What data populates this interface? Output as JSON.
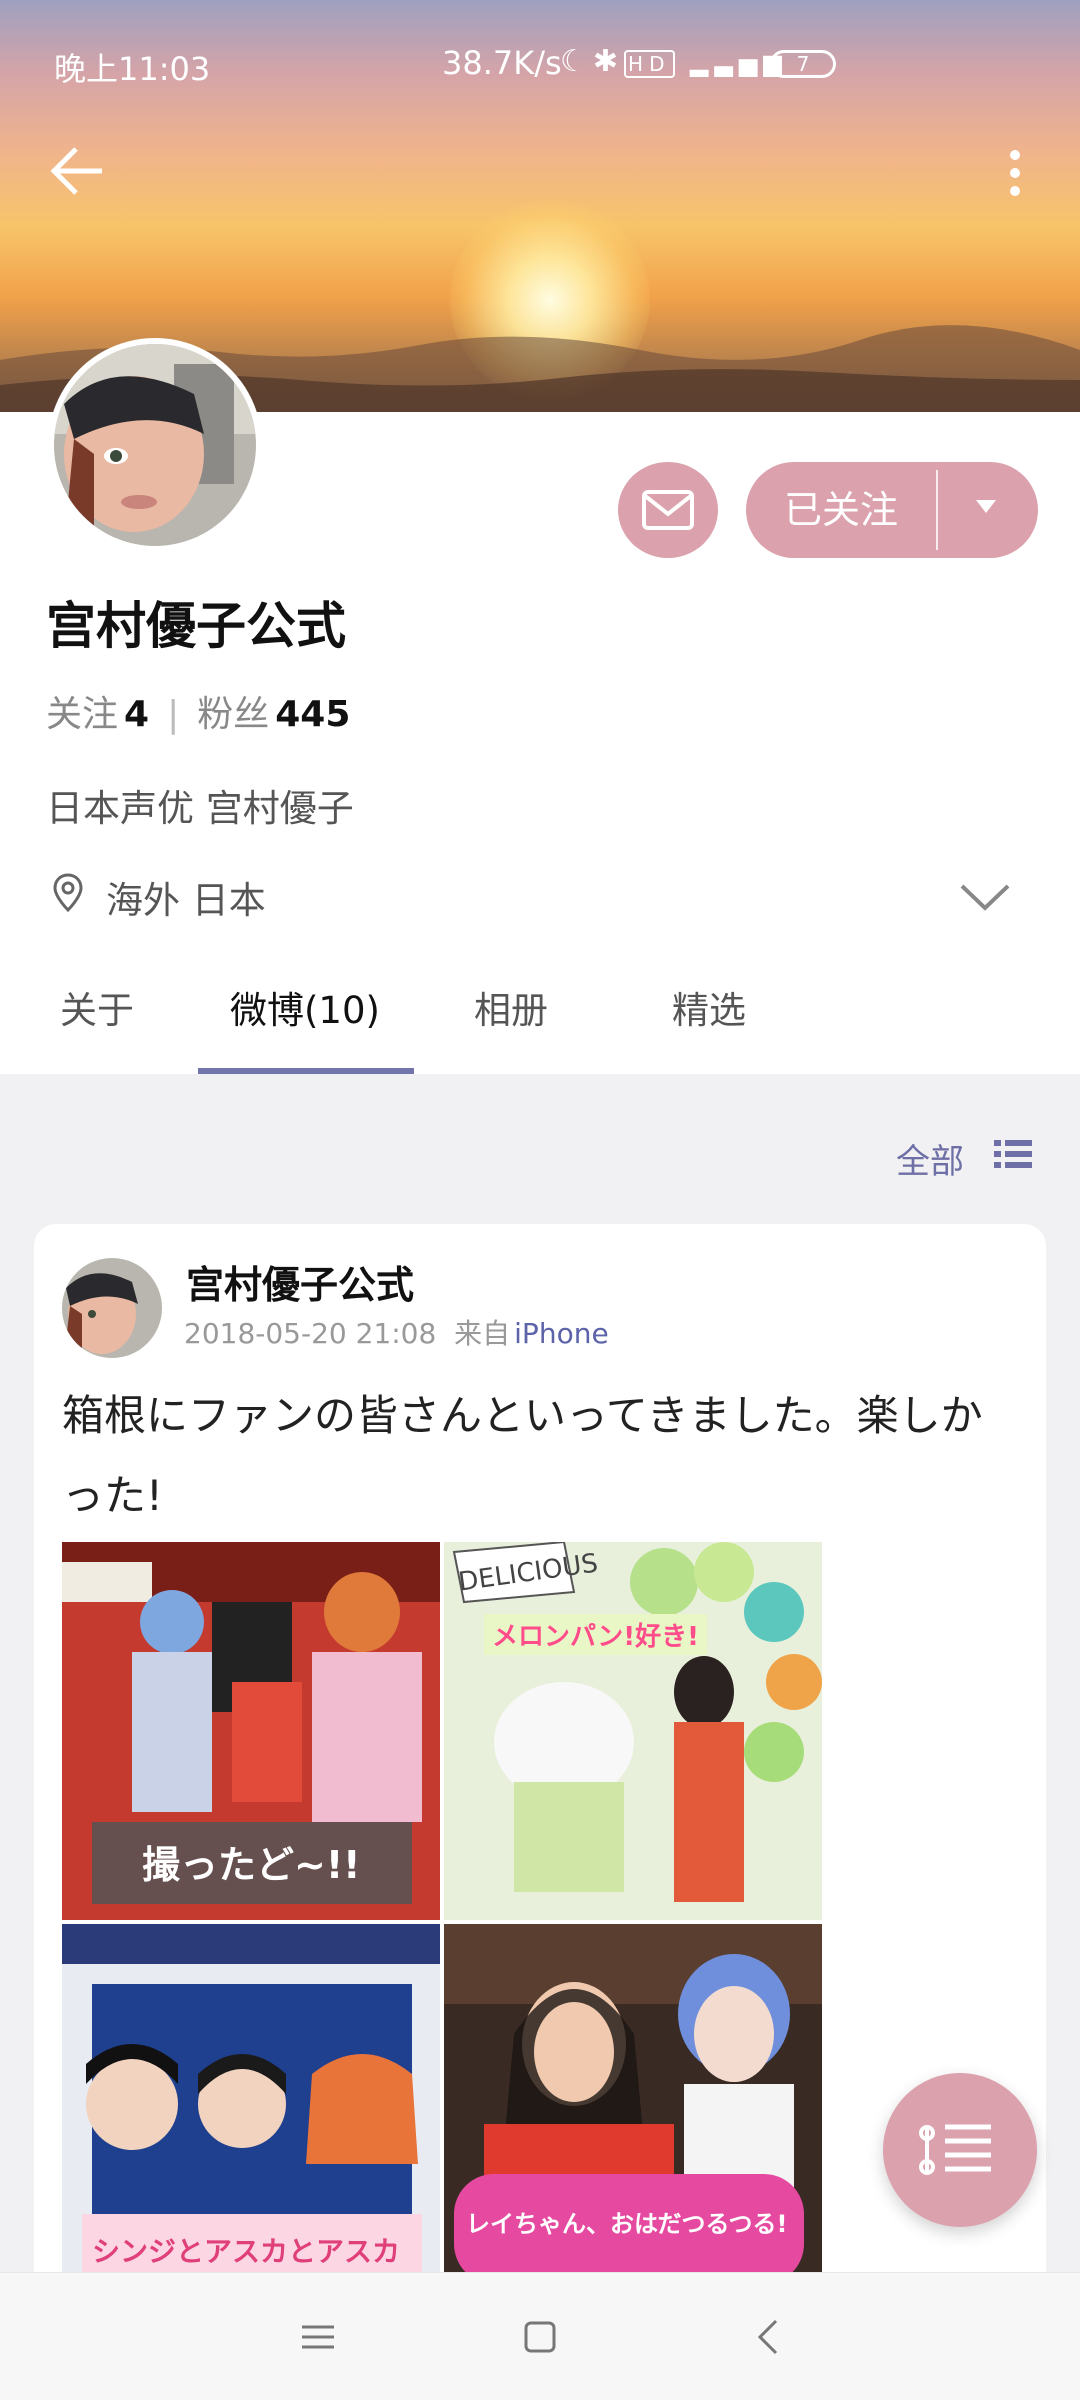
{
  "status_bar": {
    "time": "晚上11:03",
    "network_speed": "38.7K/s",
    "battery": "7",
    "icons": [
      "moon-icon",
      "bluetooth-icon",
      "hd-icon",
      "4g-signal-icon"
    ]
  },
  "header": {
    "back_icon": "arrow-left-icon",
    "more_icon": "more-vertical-icon"
  },
  "profile": {
    "name": "宫村優子公式",
    "following_label": "关注",
    "following_count": "4",
    "followers_label": "粉丝",
    "followers_count": "445",
    "bio": "日本声优 宫村優子",
    "location": "海外 日本",
    "follow_button": "已关注"
  },
  "tabs": [
    {
      "label": "关于"
    },
    {
      "label": "微博(10)",
      "active": true
    },
    {
      "label": "相册"
    },
    {
      "label": "精选"
    }
  ],
  "feed_filter": {
    "label": "全部"
  },
  "post": {
    "author": "宫村優子公式",
    "timestamp": "2018-05-20 21:08",
    "source_prefix": "来自",
    "source": "iPhone",
    "text": "箱根にファンの皆さんといってきました。楽しかった!",
    "photo_captions": [
      "撮ったど~!!",
      "メロンパン!好き!",
      "シンジとアスカとアスカ",
      "レイちゃん、おはだつるつる!"
    ],
    "photo_labels": [
      "DELICIOUS"
    ]
  },
  "colors": {
    "accent_pink": "#dba1ac",
    "accent_purple": "#7274ac",
    "link_blue": "#5c63a8"
  }
}
